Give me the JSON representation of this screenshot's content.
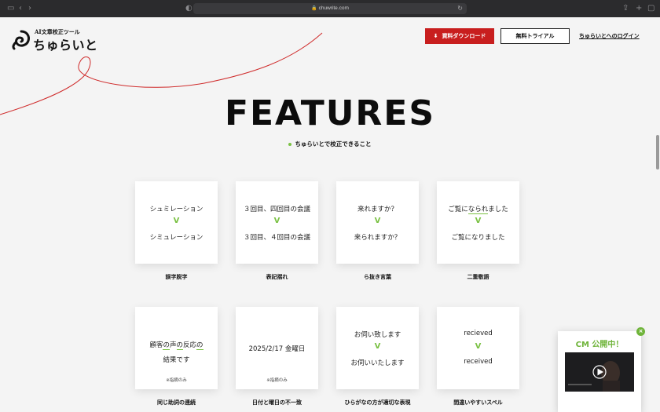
{
  "browser": {
    "url": "chuwrite.com"
  },
  "header": {
    "logo_sub": "AI文章校正ツール",
    "logo_main": "ちゅらいと",
    "download_label": "資料ダウンロード",
    "trial_label": "無料トライアル",
    "login_label": "ちゅらいとへのログイン"
  },
  "features": {
    "title": "FEATURES",
    "subtitle": "ちゅらいとで校正できること",
    "cards": [
      {
        "before": "シュミレーション",
        "after": "シミュレーション",
        "label": "誤字脱字"
      },
      {
        "before": "３回目、四回目の会議",
        "after": "３回目、４回目の会議",
        "label": "表記揺れ"
      },
      {
        "before": "来れますか？",
        "after": "来られますか？",
        "label": "ら抜き言葉"
      },
      {
        "before_pre": "ご覧に",
        "before_mark": "なられ",
        "before_post": "ました",
        "after": "ご覧になりました",
        "label": "二重敬語"
      },
      {
        "line1_a": "顧客",
        "line1_b": "の",
        "line1_c": "声",
        "line1_d": "の",
        "line1_e": "反応",
        "line1_f": "の",
        "line2": "結果です",
        "note": "※指摘のみ",
        "label": "同じ助詞の連続"
      },
      {
        "text": "2025/2/17 金曜日",
        "note": "※指摘のみ",
        "label": "日付と曜日の不一致"
      },
      {
        "before": "お伺い致します",
        "after": "お伺いいたします",
        "label": "ひらがなの方が適切な表現"
      },
      {
        "before": "recieved",
        "after": "received",
        "label": "間違いやすいスペル"
      }
    ],
    "arrow": "V"
  },
  "cm": {
    "title": "CM 公開中！",
    "close": "×"
  },
  "colors": {
    "accent_green": "#7ac143",
    "brand_red": "#c81e1e"
  }
}
